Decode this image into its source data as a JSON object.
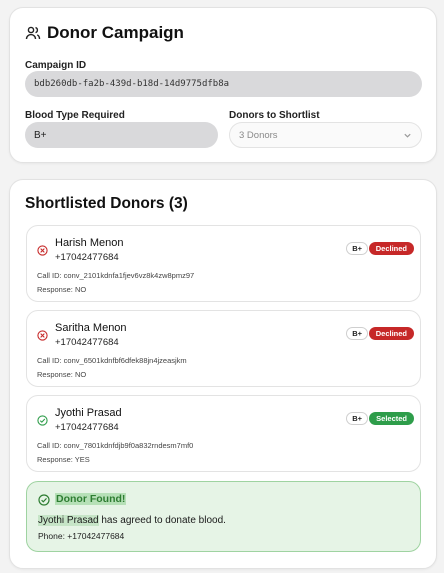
{
  "campaign": {
    "title": "Donor Campaign",
    "campaign_id_label": "Campaign ID",
    "campaign_id": "bdb260db-fa2b-439d-b18d-14d9775dfb8a",
    "blood_type_label": "Blood Type Required",
    "blood_type": "B+",
    "shortlist_label": "Donors to Shortlist",
    "shortlist_value": "3 Donors"
  },
  "shortlist": {
    "title": "Shortlisted Donors (3)",
    "donors": [
      {
        "name": "Harish Menon",
        "phone": "+17042477684",
        "blood": "B+",
        "status": "Declined",
        "call_id": "Call ID: conv_2101kdnfa1fjev6vz8k4zw8pmz97",
        "response": "Response: NO"
      },
      {
        "name": "Saritha Menon",
        "phone": "+17042477684",
        "blood": "B+",
        "status": "Declined",
        "call_id": "Call ID: conv_6501kdnfbf6dfek88jn4jzeasjkm",
        "response": "Response: NO"
      },
      {
        "name": "Jyothi Prasad",
        "phone": "+17042477684",
        "blood": "B+",
        "status": "Selected",
        "call_id": "Call ID: conv_7801kdnfdjb9f0a832rndesm7mf0",
        "response": "Response: YES"
      }
    ],
    "found": {
      "heading": "Donor Found!",
      "donor_name": "Jyothi Prasad",
      "message_rest": " has agreed to donate blood.",
      "phone": "Phone: +17042477684"
    }
  },
  "colors": {
    "declined": "#c62828",
    "selected": "#2e9d4a",
    "found_bg": "#e6f4e6"
  }
}
